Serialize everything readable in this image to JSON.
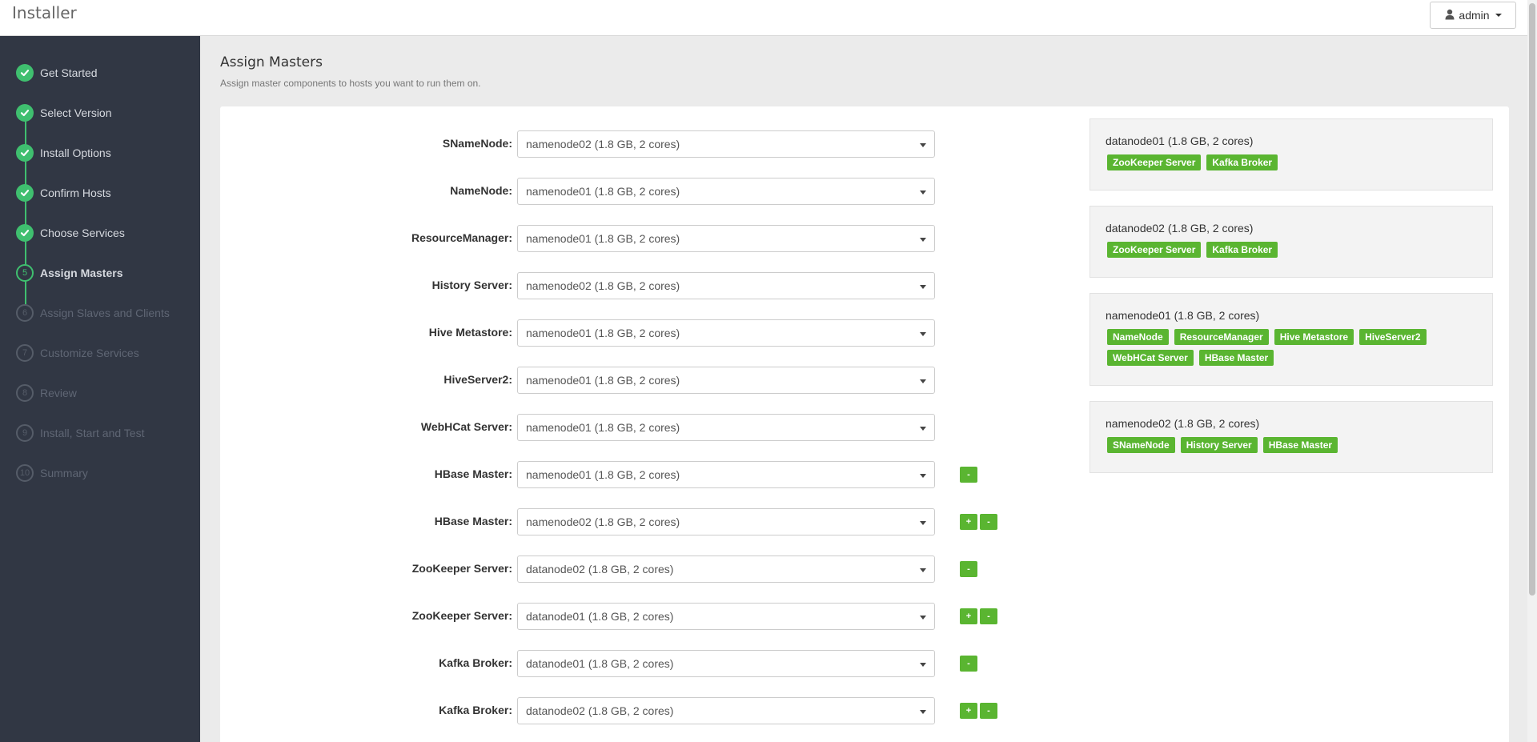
{
  "header": {
    "app_title": "Installer",
    "user_label": "admin"
  },
  "sidebar": {
    "steps": [
      {
        "marker": "",
        "label": "Get Started",
        "state": "done"
      },
      {
        "marker": "",
        "label": "Select Version",
        "state": "done"
      },
      {
        "marker": "",
        "label": "Install Options",
        "state": "done"
      },
      {
        "marker": "",
        "label": "Confirm Hosts",
        "state": "done"
      },
      {
        "marker": "",
        "label": "Choose Services",
        "state": "done"
      },
      {
        "marker": "5",
        "label": "Assign Masters",
        "state": "active"
      },
      {
        "marker": "6",
        "label": "Assign Slaves and Clients",
        "state": "todo"
      },
      {
        "marker": "7",
        "label": "Customize Services",
        "state": "todo"
      },
      {
        "marker": "8",
        "label": "Review",
        "state": "todo"
      },
      {
        "marker": "9",
        "label": "Install, Start and Test",
        "state": "todo"
      },
      {
        "marker": "10",
        "label": "Summary",
        "state": "todo"
      }
    ]
  },
  "main": {
    "title": "Assign Masters",
    "subtitle": "Assign master components to hosts you want to run them on.",
    "assignments": [
      {
        "label": "SNameNode:",
        "value": "namenode02 (1.8 GB, 2 cores)",
        "buttons": []
      },
      {
        "label": "NameNode:",
        "value": "namenode01 (1.8 GB, 2 cores)",
        "buttons": []
      },
      {
        "label": "ResourceManager:",
        "value": "namenode01 (1.8 GB, 2 cores)",
        "buttons": []
      },
      {
        "label": "History Server:",
        "value": "namenode02 (1.8 GB, 2 cores)",
        "buttons": []
      },
      {
        "label": "Hive Metastore:",
        "value": "namenode01 (1.8 GB, 2 cores)",
        "buttons": []
      },
      {
        "label": "HiveServer2:",
        "value": "namenode01 (1.8 GB, 2 cores)",
        "buttons": []
      },
      {
        "label": "WebHCat Server:",
        "value": "namenode01 (1.8 GB, 2 cores)",
        "buttons": []
      },
      {
        "label": "HBase Master:",
        "value": "namenode01 (1.8 GB, 2 cores)",
        "buttons": [
          "-"
        ]
      },
      {
        "label": "HBase Master:",
        "value": "namenode02 (1.8 GB, 2 cores)",
        "buttons": [
          "+",
          "-"
        ]
      },
      {
        "label": "ZooKeeper Server:",
        "value": "datanode02 (1.8 GB, 2 cores)",
        "buttons": [
          "-"
        ]
      },
      {
        "label": "ZooKeeper Server:",
        "value": "datanode01 (1.8 GB, 2 cores)",
        "buttons": [
          "+",
          "-"
        ]
      },
      {
        "label": "Kafka Broker:",
        "value": "datanode01 (1.8 GB, 2 cores)",
        "buttons": [
          "-"
        ]
      },
      {
        "label": "Kafka Broker:",
        "value": "datanode02 (1.8 GB, 2 cores)",
        "buttons": [
          "+",
          "-"
        ]
      }
    ],
    "hosts": [
      {
        "name": "datanode01 (1.8 GB, 2 cores)",
        "components": [
          "ZooKeeper Server",
          "Kafka Broker"
        ]
      },
      {
        "name": "datanode02 (1.8 GB, 2 cores)",
        "components": [
          "ZooKeeper Server",
          "Kafka Broker"
        ]
      },
      {
        "name": "namenode01 (1.8 GB, 2 cores)",
        "components": [
          "NameNode",
          "ResourceManager",
          "Hive Metastore",
          "HiveServer2",
          "WebHCat Server",
          "HBase Master"
        ]
      },
      {
        "name": "namenode02 (1.8 GB, 2 cores)",
        "components": [
          "SNameNode",
          "History Server",
          "HBase Master"
        ]
      }
    ]
  },
  "colors": {
    "sidebar_bg": "#313744",
    "step_done": "#3fbf6f",
    "component_tag": "#5ab531"
  }
}
